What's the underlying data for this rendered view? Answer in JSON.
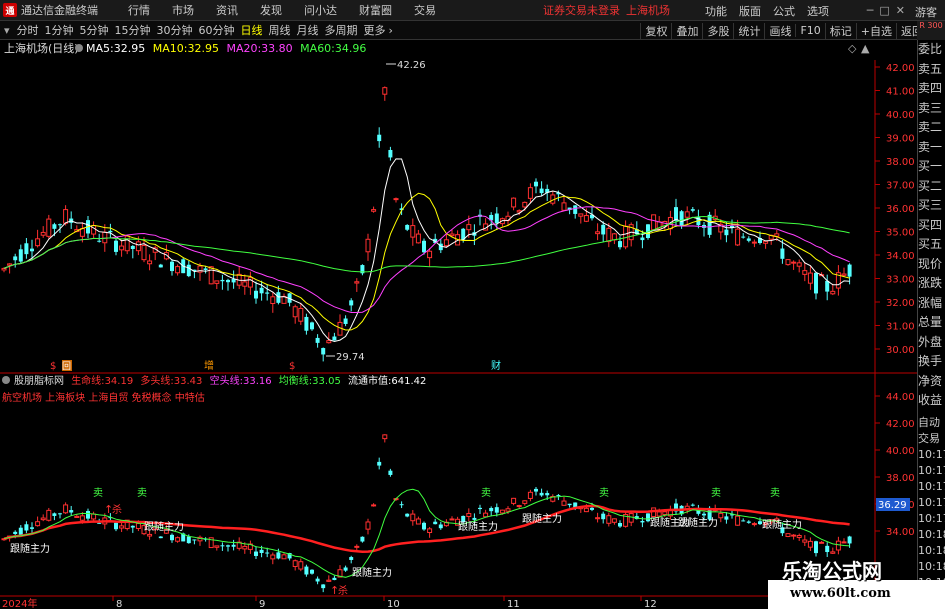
{
  "menubar": {
    "app_title": "通达信金融终端",
    "items": [
      "行情",
      "市场",
      "资讯",
      "发现",
      "问小达",
      "财富圈",
      "交易"
    ],
    "broker_status": "证券交易未登录",
    "stock_name": "上海机场",
    "right_items": [
      "功能",
      "版面",
      "公式",
      "选项"
    ],
    "guest": "游客"
  },
  "toolbar": {
    "periods": [
      "分时",
      "1分钟",
      "5分钟",
      "15分钟",
      "30分钟",
      "60分钟",
      "日线",
      "周线",
      "月线",
      "多周期",
      "更多"
    ],
    "active": "日线",
    "right_buttons": [
      "复权",
      "叠加",
      "多股",
      "统计",
      "画线",
      "F10",
      "标记",
      "+自选",
      "返回"
    ],
    "badge": "R 300"
  },
  "main_chart": {
    "title": "上海机场(日线)",
    "ma": [
      {
        "label": "MA5:",
        "value": "32.95",
        "color": "#ffffff"
      },
      {
        "label": "MA10:",
        "value": "32.95",
        "color": "#ffff00"
      },
      {
        "label": "MA20:",
        "value": "33.80",
        "color": "#ff40ff"
      },
      {
        "label": "MA60:",
        "value": "34.96",
        "color": "#40ff40"
      }
    ],
    "y_ticks": [
      "42.00",
      "41.00",
      "40.00",
      "39.00",
      "38.00",
      "37.00",
      "36.00",
      "35.00",
      "34.00",
      "33.00",
      "32.00",
      "31.00",
      "30.00"
    ],
    "high_label": "42.26",
    "low_label": "29.74",
    "markers": [
      "$",
      "回",
      "增",
      "$",
      "财"
    ]
  },
  "indicator": {
    "name": "股朋脂标网",
    "lines": [
      {
        "label": "生命线:",
        "value": "34.19",
        "color": "#ff3030"
      },
      {
        "label": "多头线:",
        "value": "33.43",
        "color": "#ff3030"
      },
      {
        "label": "空头线:",
        "value": "33.16",
        "color": "#ff40ff"
      },
      {
        "label": "均衡线:",
        "value": "33.05",
        "color": "#40ff40"
      }
    ],
    "market_cap_label": "流通市值:",
    "market_cap_value": "641.42",
    "sector_text": "航空机场 上海板块 上海自贸 免税概念 中特估",
    "y_ticks": [
      "44.00",
      "42.00",
      "40.00",
      "38.00",
      "36.00",
      "34.00"
    ],
    "current_price": "36.29",
    "follow_label": "跟随主力",
    "sell_label": "卖",
    "kill_label": "杀"
  },
  "x_axis": [
    "2024年",
    "8",
    "9",
    "10",
    "11",
    "12"
  ],
  "quote_panel": {
    "upper": [
      "委比",
      "卖五",
      "卖四",
      "卖三",
      "卖二",
      "卖一",
      "买一",
      "买二",
      "买三",
      "买四",
      "买五",
      "现价",
      "涨跌",
      "涨幅",
      "总量",
      "外盘",
      "换手",
      "净资",
      "收益"
    ],
    "lower": [
      "自动",
      "交易",
      "10:17",
      "10:17",
      "10:17",
      "10:17",
      "10:17",
      "10:18",
      "10:18",
      "10:18",
      "10:18"
    ]
  },
  "watermark": {
    "title": "乐淘公式网",
    "url": "www.60lt.com"
  },
  "colors": {
    "up": "#ff3030",
    "down": "#54ffff",
    "ma5": "#ffffff",
    "ma10": "#ffff00",
    "ma20": "#ff40ff",
    "ma60": "#40ff40"
  }
}
